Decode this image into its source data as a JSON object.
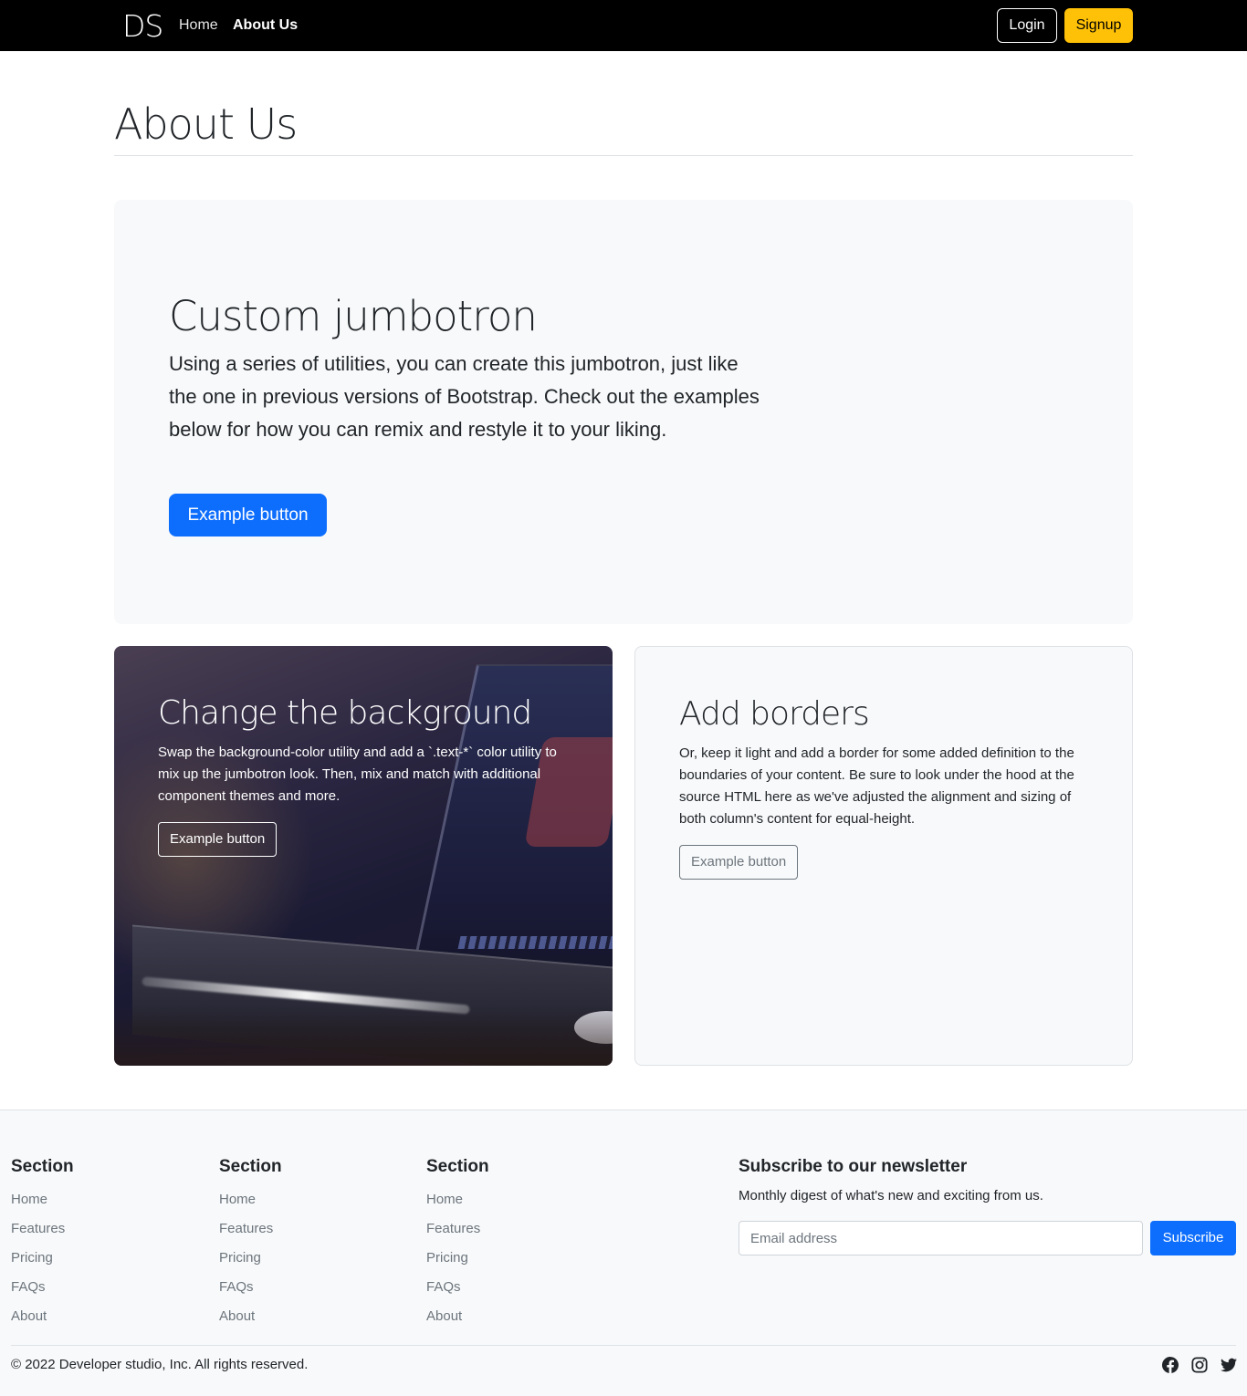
{
  "navbar": {
    "brand": "DS",
    "links": [
      {
        "label": "Home",
        "active": false
      },
      {
        "label": "About Us",
        "active": true
      }
    ],
    "login_label": "Login",
    "signup_label": "Signup"
  },
  "page": {
    "title": "About Us"
  },
  "jumbotron": {
    "title": "Custom jumbotron",
    "text": "Using a series of utilities, you can create this jumbotron, just like the one in previous versions of Bootstrap. Check out the examples below for how you can remix and restyle it to your liking.",
    "button_label": "Example button"
  },
  "card_background": {
    "title": "Change the background",
    "text": "Swap the background-color utility and add a `.text-*` color utility to mix up the jumbotron look. Then, mix and match with additional component themes and more.",
    "button_label": "Example button"
  },
  "card_borders": {
    "title": "Add borders",
    "text": "Or, keep it light and add a border for some added definition to the boundaries of your content. Be sure to look under the hood at the source HTML here as we've adjusted the alignment and sizing of both column's content for equal-height.",
    "button_label": "Example button"
  },
  "footer": {
    "sections": [
      {
        "heading": "Section",
        "links": [
          "Home",
          "Features",
          "Pricing",
          "FAQs",
          "About"
        ]
      },
      {
        "heading": "Section",
        "links": [
          "Home",
          "Features",
          "Pricing",
          "FAQs",
          "About"
        ]
      },
      {
        "heading": "Section",
        "links": [
          "Home",
          "Features",
          "Pricing",
          "FAQs",
          "About"
        ]
      }
    ],
    "newsletter": {
      "heading": "Subscribe to our newsletter",
      "subtext": "Monthly digest of what's new and exciting from us.",
      "email_placeholder": "Email address",
      "subscribe_label": "Subscribe"
    },
    "copyright": "© 2022 Developer studio, Inc. All rights reserved.",
    "social_icons": [
      "facebook-icon",
      "instagram-icon",
      "twitter-icon"
    ]
  },
  "colors": {
    "navbar_bg": "#000000",
    "signup_bg": "#ffc107",
    "primary": "#0d6efd",
    "light_bg": "#f8f9fa"
  }
}
